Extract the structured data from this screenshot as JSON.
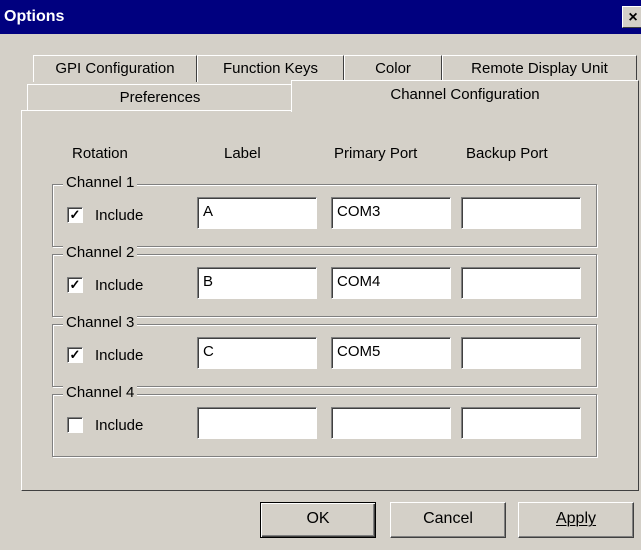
{
  "window": {
    "title": "Options",
    "close_glyph": "×"
  },
  "tabs": {
    "row1": [
      "GPI Configuration",
      "Function Keys",
      "Color",
      "Remote Display Unit"
    ],
    "row2": [
      "Preferences",
      "Channel Configuration"
    ],
    "active": "Channel Configuration"
  },
  "columns": {
    "rotation": "Rotation",
    "label": "Label",
    "primary_port": "Primary Port",
    "backup_port": "Backup Port"
  },
  "channels": [
    {
      "name": "Channel 1",
      "include_label": "Include",
      "included": true,
      "check_glyph": "✓",
      "label": "A",
      "primary_port": "COM3",
      "backup_port": ""
    },
    {
      "name": "Channel 2",
      "include_label": "Include",
      "included": true,
      "check_glyph": "✓",
      "label": "B",
      "primary_port": "COM4",
      "backup_port": ""
    },
    {
      "name": "Channel 3",
      "include_label": "Include",
      "included": true,
      "check_glyph": "✓",
      "label": "C",
      "primary_port": "COM5",
      "backup_port": ""
    },
    {
      "name": "Channel 4",
      "include_label": "Include",
      "included": false,
      "check_glyph": "",
      "label": "",
      "primary_port": "",
      "backup_port": ""
    }
  ],
  "buttons": {
    "ok": "OK",
    "cancel": "Cancel",
    "apply": "Apply"
  },
  "colors": {
    "titlebar": "#00007f",
    "face": "#d4d0c8"
  }
}
